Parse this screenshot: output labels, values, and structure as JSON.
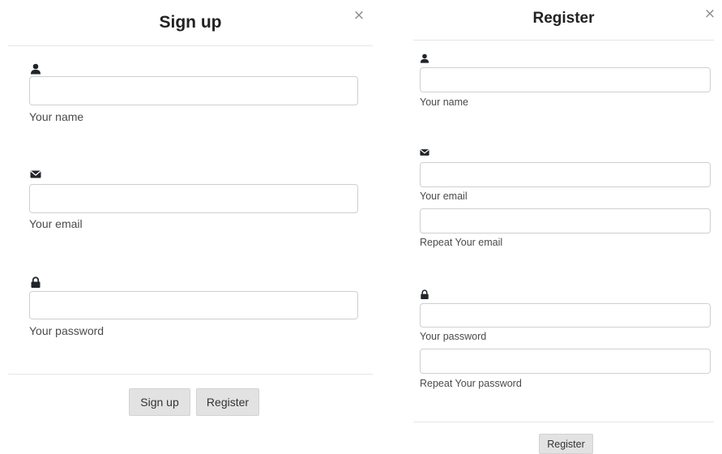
{
  "signup": {
    "title": "Sign up",
    "close_label": "×",
    "name_help": "Your name",
    "email_help": "Your email",
    "password_help": "Your password",
    "signup_button": "Sign up",
    "register_button": "Register"
  },
  "register": {
    "title": "Register",
    "close_label": "×",
    "name_help": "Your name",
    "email_help": "Your email",
    "repeat_email_help": "Repeat Your email",
    "password_help": "Your password",
    "repeat_password_help": "Repeat Your password",
    "register_button": "Register"
  },
  "icons": {
    "user": "user-icon",
    "email": "envelope-icon",
    "password": "lock-icon"
  }
}
